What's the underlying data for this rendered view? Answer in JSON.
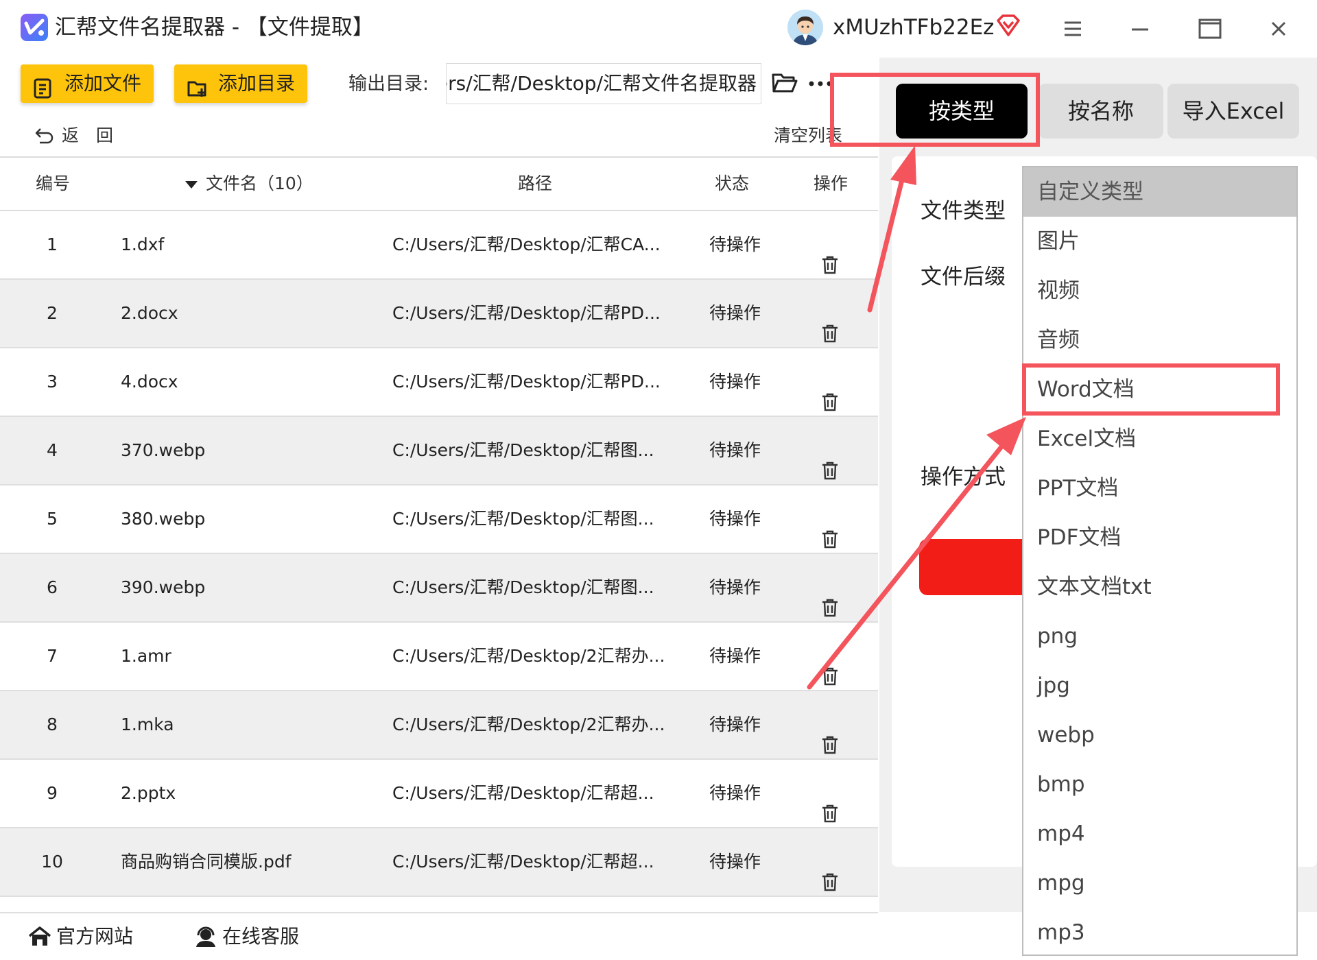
{
  "window": {
    "title": "汇帮文件名提取器 - 【文件提取】",
    "username": "xMUzhTFb22Ez"
  },
  "toolbar": {
    "add_file": "添加文件",
    "add_dir": "添加目录",
    "output_label": "输出目录:",
    "output_path": "C:/Users/汇帮/Desktop/汇帮文件名提取器",
    "back": "返　回",
    "clear_list": "清空列表"
  },
  "table": {
    "headers": {
      "num": "编号",
      "name": "文件名（10）",
      "path": "路径",
      "status": "状态",
      "op": "操作"
    },
    "rows": [
      {
        "num": "1",
        "name": "1.dxf",
        "path": "C:/Users/汇帮/Desktop/汇帮CA...",
        "status": "待操作"
      },
      {
        "num": "2",
        "name": "2.docx",
        "path": "C:/Users/汇帮/Desktop/汇帮PD...",
        "status": "待操作"
      },
      {
        "num": "3",
        "name": "4.docx",
        "path": "C:/Users/汇帮/Desktop/汇帮PD...",
        "status": "待操作"
      },
      {
        "num": "4",
        "name": "370.webp",
        "path": "C:/Users/汇帮/Desktop/汇帮图...",
        "status": "待操作"
      },
      {
        "num": "5",
        "name": "380.webp",
        "path": "C:/Users/汇帮/Desktop/汇帮图...",
        "status": "待操作"
      },
      {
        "num": "6",
        "name": "390.webp",
        "path": "C:/Users/汇帮/Desktop/汇帮图...",
        "status": "待操作"
      },
      {
        "num": "7",
        "name": "1.amr",
        "path": "C:/Users/汇帮/Desktop/2汇帮办...",
        "status": "待操作"
      },
      {
        "num": "8",
        "name": "1.mka",
        "path": "C:/Users/汇帮/Desktop/2汇帮办...",
        "status": "待操作"
      },
      {
        "num": "9",
        "name": "2.pptx",
        "path": "C:/Users/汇帮/Desktop/汇帮超...",
        "status": "待操作"
      },
      {
        "num": "10",
        "name": "商品购销合同模版.pdf",
        "path": "C:/Users/汇帮/Desktop/汇帮超...",
        "status": "待操作"
      }
    ]
  },
  "footer": {
    "website": "官方网站",
    "support": "在线客服"
  },
  "right_panel": {
    "tabs": [
      "按类型",
      "按名称",
      "导入Excel"
    ],
    "labels": {
      "file_type": "文件类型",
      "file_suffix": "文件后缀",
      "operation": "操作方式"
    }
  },
  "dropdown": {
    "selected": "自定义类型",
    "options": [
      "自定义类型",
      "图片",
      "视频",
      "音频",
      "Word文档",
      "Excel文档",
      "PPT文档",
      "PDF文档",
      "文本文档txt",
      "png",
      "jpg",
      "webp",
      "bmp",
      "mp4",
      "mpg",
      "mp3"
    ]
  },
  "colors": {
    "accent_yellow": "#fec40c",
    "tab_active": "#000000",
    "start_red": "#f21d17",
    "annotation_red": "#f4545b",
    "row_alt": "#efefef"
  },
  "icons": [
    "app-logo-icon",
    "vip-icon",
    "menu-icon",
    "minimize-icon",
    "maximize-icon",
    "close-icon",
    "file-add-icon",
    "folder-add-icon",
    "folder-icon",
    "more-icon",
    "back-icon",
    "sort-down-icon",
    "trash-icon",
    "home-icon",
    "headset-icon"
  ]
}
